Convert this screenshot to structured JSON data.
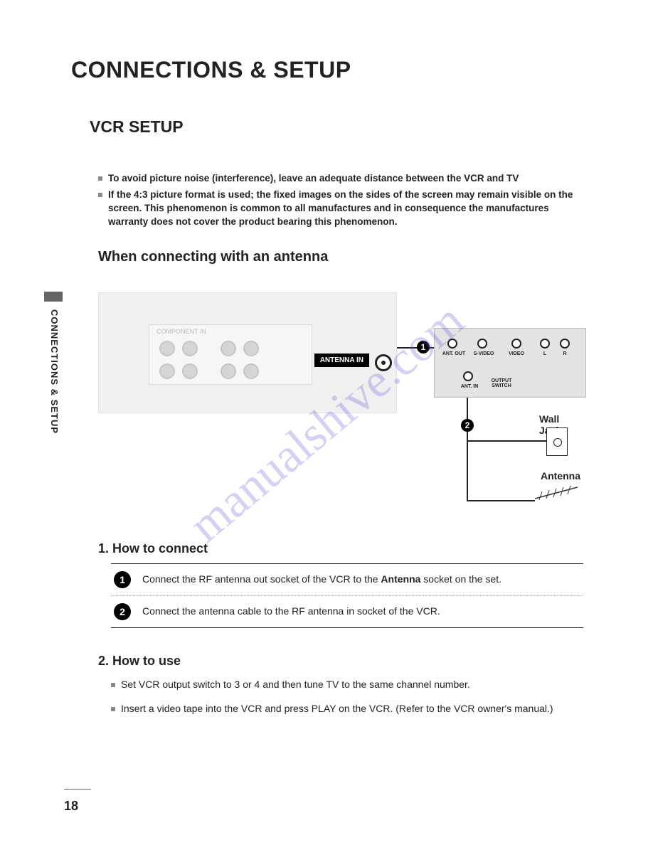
{
  "watermark": "manualshive.com",
  "title": "CONNECTIONS & SETUP",
  "subtitle": "VCR SETUP",
  "vertical_tab_label": "CONNECTIONS & SETUP",
  "notes": [
    "To avoid picture noise (interference), leave an adequate distance between the VCR and TV",
    "If the 4:3 picture format is used; the fixed images on the sides of the screen may remain visible on the screen. This phenomenon is common to all manufactures and in consequence the manufactures warranty does not cover the product bearing this phenomenon."
  ],
  "antenna_heading": "When connecting with an antenna",
  "diagram": {
    "tv_component_label": "COMPONENT IN",
    "antenna_in_badge": "ANTENNA IN",
    "vcr_ports": {
      "ant_out": "ANT. OUT",
      "s_video": "S-VIDEO",
      "video": "VIDEO",
      "l": "L",
      "r": "R",
      "ant_in": "ANT. IN",
      "output_switch": "OUTPUT SWITCH"
    },
    "step1_badge": "1",
    "step2_badge": "2",
    "wall_jack_label": "Wall Jack",
    "antenna_label": "Antenna"
  },
  "how_connect": {
    "heading": "1. How to connect",
    "steps": [
      {
        "n": "1",
        "before": "Connect the RF antenna out socket of the VCR to the ",
        "bold": "Antenna",
        "after": " socket on the set."
      },
      {
        "n": "2",
        "before": "Connect the antenna cable to the RF antenna in socket of the VCR.",
        "bold": "",
        "after": ""
      }
    ]
  },
  "how_use": {
    "heading": "2. How to use",
    "items": [
      "Set VCR output switch to 3 or 4 and then tune TV to the same channel number.",
      "Insert a video tape into the VCR and press PLAY on the VCR. (Refer to the VCR owner's manual.)"
    ]
  },
  "page_number": "18"
}
